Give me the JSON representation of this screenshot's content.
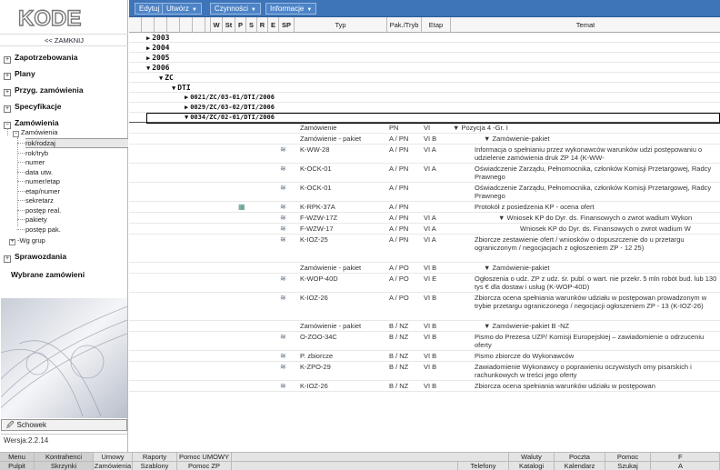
{
  "app": {
    "logo": "KODE",
    "back_label": "<< ZAMKNIJ",
    "version": "Wersja:2.2.14",
    "clipboard_label": "Schowek"
  },
  "menu": {
    "edit": "Edytuj",
    "create": "Utwórz",
    "actions": "Czynności",
    "info": "Informacje"
  },
  "sidebar": {
    "items": [
      {
        "label": "Zapotrzebowania",
        "toggle": "+"
      },
      {
        "label": "Plany",
        "toggle": "+"
      },
      {
        "label": "Przyg. zamówienia",
        "toggle": "+"
      },
      {
        "label": "Specyfikacje",
        "toggle": "+"
      },
      {
        "label": "Zamówienia",
        "toggle": "−"
      }
    ],
    "zamowienia_child": "Zamówienia",
    "sub_items": [
      "rok/rodzaj",
      "rok/tryb",
      "numer",
      "data utw.",
      "numer/etap",
      "etap/numer",
      "sekretarz",
      "postęp real.",
      "pakiety",
      "postęp pak."
    ],
    "wg_grup": "-Wg grup",
    "sprawozdania": "Sprawozdania",
    "wybrane": "Wybrane zamówieni"
  },
  "columns": {
    "w": "W",
    "st": "St",
    "p": "P",
    "s": "S",
    "r": "R",
    "e": "E",
    "sp": "SP",
    "typ": "Typ",
    "pak": "Pak./Tryb",
    "etap": "Etap",
    "temat": "Temat"
  },
  "tree": {
    "y2003": "2003",
    "y2004": "2004",
    "y2005": "2005",
    "y2006": "2006",
    "zc": "ZC",
    "dti": "DTI",
    "n1": "0021/ZC/03-01/DTI/2006",
    "n2": "0029/ZC/03-02/DTI/2006",
    "n3": "0034/ZC/02-01/DTI/2006"
  },
  "rows": [
    {
      "typ": "Zamówienie",
      "pak": "PN",
      "etap": "VI",
      "temat": "▼ Pozycja 4 -Gr. I",
      "icon": false,
      "lines": 1
    },
    {
      "typ": "Zamówienie - pakiet",
      "pak": "A / PN",
      "etap": "VI B",
      "temat": "▼ Zamówienie-pakiet",
      "icon": false,
      "lines": 1
    },
    {
      "typ": "K-WW-28",
      "pak": "A / PN",
      "etap": "VI A",
      "temat": "Informacja o spełnianiu przez wykonawców warunków udzi postępowaniu o udzielenie zamówienia druk ZP 14 (K-WW-",
      "icon": true,
      "lines": 2
    },
    {
      "typ": "K-OCK-01",
      "pak": "A / PN",
      "etap": "VI A",
      "temat": "Oświadczenie Zarządu, Pełnomocnika, członków Komisji Przetargowej, Radcy Prawnego",
      "icon": true,
      "lines": 2
    },
    {
      "typ": "K-OCK-01",
      "pak": "A / PN",
      "etap": "",
      "temat": "Oświadczenie Zarządu, Pełnomocnika, członków Komisji Przetargowej, Radcy Prawnego",
      "icon": true,
      "lines": 2
    },
    {
      "typ": "K-RPK-37A",
      "pak": "A / PN",
      "etap": "",
      "temat": "Protokół z posiedzenia KP - ocena ofert",
      "icon": true,
      "extra_icon": true,
      "lines": 1
    },
    {
      "typ": "F-WZW-17Z",
      "pak": "A / PN",
      "etap": "VI A",
      "temat": "▼ Wniosek KP do Dyr. ds. Finansowych o zwrot wadium Wykon",
      "icon": true,
      "lines": 1
    },
    {
      "typ": "F-WZW-17",
      "pak": "A / PN",
      "etap": "VI A",
      "temat": "Wniosek KP do Dyr. ds. Finansowych o zwrot wadium W",
      "icon": true,
      "lines": 1
    },
    {
      "typ": "K-IOZ-25",
      "pak": "A / PN",
      "etap": "VI A",
      "temat": "Zbiorcze zestawienie ofert / wniosków o dopuszczenie do u przetargu ograniczonym / negocjacjach z ogłoszeniem ZP - 12 25)",
      "icon": true,
      "lines": 3
    },
    {
      "typ": "Zamówienie - pakiet",
      "pak": "A / PO",
      "etap": "VI B",
      "temat": "▼ Zamówienie-pakiet",
      "icon": false,
      "lines": 1
    },
    {
      "typ": "K-WOP-40D",
      "pak": "A / PO",
      "etap": "VI E",
      "temat": "Ogłoszenia o udz. ZP z udz. śr. publ. o wart. nie przekr. 5 mln robót bud. lub 130 tys € dla dostaw i usług (K-WOP-40D)",
      "icon": true,
      "lines": 2
    },
    {
      "typ": "K-IOZ-26",
      "pak": "A / PO",
      "etap": "VI B",
      "temat": "Zbiorcza ocena spełniania warunków udziału w postępowan prowadzonym w trybie przetargu ograniczonego / negocjacji ogłoszeniem ZP - 13 (K-IOZ-26)",
      "icon": true,
      "lines": 3
    },
    {
      "typ": "Zamówienie - pakiet",
      "pak": "B / NZ",
      "etap": "VI B",
      "temat": "▼ Zamówienie-pakiet B -NZ",
      "icon": false,
      "lines": 1
    },
    {
      "typ": "O-ZOO-34C",
      "pak": "B / NZ",
      "etap": "VI B",
      "temat": "Pismo do Prezesa UZP/ Komisji Europejskiej – zawiadomienie o odrzuceniu oferty",
      "icon": true,
      "lines": 2
    },
    {
      "typ": "P. zbiorcze",
      "pak": "B / NZ",
      "etap": "VI B",
      "temat": "Pismo zbiorcze do Wykonawców",
      "icon": true,
      "lines": 1
    },
    {
      "typ": "K-ZPO-29",
      "pak": "B / NZ",
      "etap": "VI B",
      "temat": "Zawiadomienie Wykonawcy o poprawieniu oczywistych omy pisarskich i rachunkowych w treści jego oferty",
      "icon": true,
      "lines": 2
    },
    {
      "typ": "K-IOZ-26",
      "pak": "B / NZ",
      "etap": "VI B",
      "temat": "Zbiorcza ocena spełniania warunków udziału w postępowan",
      "icon": true,
      "lines": 1
    }
  ],
  "bottom1": [
    "Menu",
    "Kontrahenci",
    "Umowy",
    "Raporty",
    "Pomoc UMOWY",
    "",
    "Waluty",
    "Poczta",
    "Pomoc",
    "F"
  ],
  "bottom2": [
    "Pulpit",
    "Skrzynki",
    "Zamówienia",
    "Szablony",
    "Pomoc ZP",
    "Telefony",
    "Katalogi",
    "Kalendarz",
    "Szukaj",
    "A"
  ]
}
